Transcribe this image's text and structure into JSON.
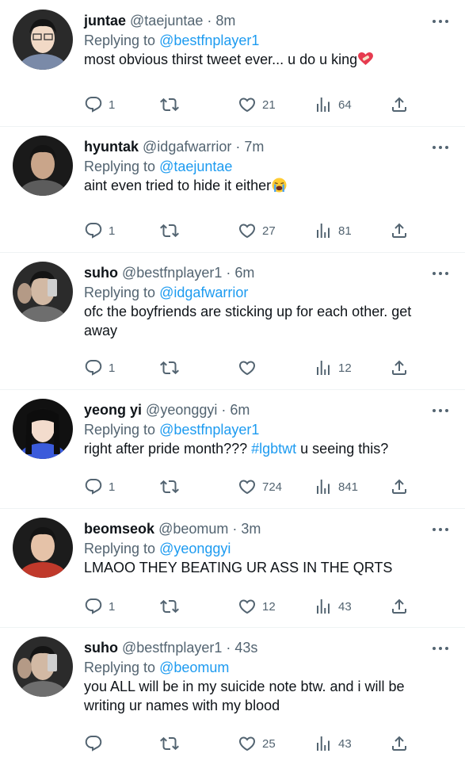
{
  "tweets": [
    {
      "name": "juntae",
      "handle": "@taejuntae",
      "time": "8m",
      "reply_prefix": "Replying to",
      "reply_to": "@bestfnplayer1",
      "text": "most obvious thirst tweet ever... u do u king",
      "emoji": "heart-with-bandage",
      "replies": "1",
      "retweets": "",
      "likes": "21",
      "views": "64",
      "avatar_colors": [
        "#2a2a2a",
        "#f1d9c6",
        "#7a8aa8"
      ]
    },
    {
      "name": "hyuntak",
      "handle": "@idgafwarrior",
      "time": "7m",
      "reply_prefix": "Replying to",
      "reply_to": "@taejuntae",
      "text": "aint even tried to hide it either",
      "emoji": "loudly-crying-face",
      "replies": "1",
      "retweets": "",
      "likes": "27",
      "views": "81",
      "avatar_colors": [
        "#1a1a1a",
        "#c9a58a",
        "#5c5c5c"
      ]
    },
    {
      "name": "suho",
      "handle": "@bestfnplayer1",
      "time": "6m",
      "reply_prefix": "Replying to",
      "reply_to": "@idgafwarrior",
      "text": "ofc the boyfriends are sticking up for each other. get away",
      "emoji": "",
      "replies": "1",
      "retweets": "",
      "likes": "",
      "views": "12",
      "avatar_colors": [
        "#2b2b2b",
        "#d2b9a4",
        "#6e6e6e"
      ]
    },
    {
      "name": "yeong yi",
      "handle": "@yeonggyi",
      "time": "6m",
      "reply_prefix": "Replying to",
      "reply_to": "@bestfnplayer1",
      "text": "right after pride month??? ",
      "hashtag": "#lgbtwt",
      "text_after": " u seeing this?",
      "emoji": "",
      "replies": "1",
      "retweets": "",
      "likes": "724",
      "views": "841",
      "avatar_colors": [
        "#111111",
        "#f3dccd",
        "#3b5bdb"
      ]
    },
    {
      "name": "beomseok",
      "handle": "@beomum",
      "time": "3m",
      "reply_prefix": "Replying to",
      "reply_to": "@yeonggyi",
      "text": "LMAOO THEY BEATING UR ASS IN THE QRTS",
      "emoji": "",
      "replies": "1",
      "retweets": "",
      "likes": "12",
      "views": "43",
      "avatar_colors": [
        "#1c1c1c",
        "#e5c2a8",
        "#c0392b"
      ]
    },
    {
      "name": "suho",
      "handle": "@bestfnplayer1",
      "time": "43s",
      "reply_prefix": "Replying to",
      "reply_to": "@beomum",
      "text": "you ALL will be in my suicide note btw. and i will be writing ur names with my blood",
      "emoji": "",
      "replies": "",
      "retweets": "",
      "likes": "25",
      "views": "43",
      "avatar_colors": [
        "#2b2b2b",
        "#d2b9a4",
        "#6e6e6e"
      ]
    }
  ],
  "colors": {
    "text": "#0f1419",
    "muted": "#536471",
    "link": "#1d9bf0",
    "divider": "#eff3f4"
  }
}
